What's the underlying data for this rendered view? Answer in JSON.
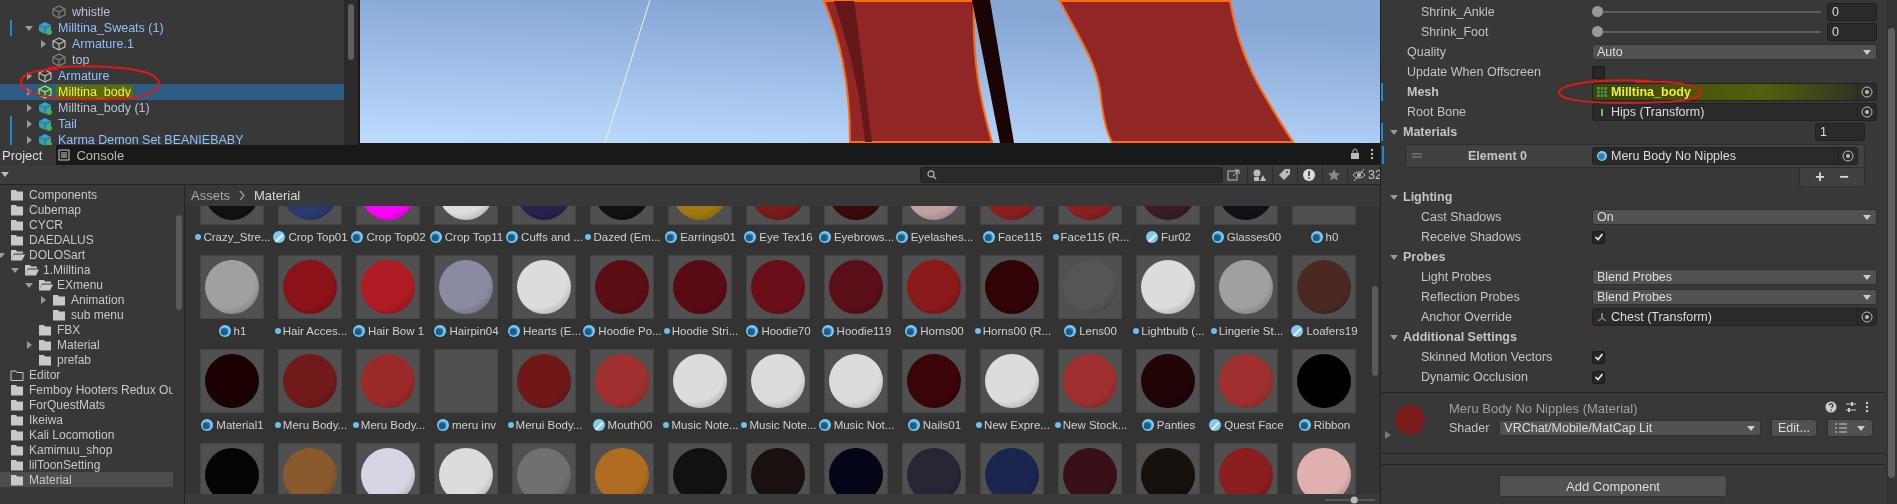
{
  "hierarchy": {
    "continued_children": [
      {
        "label": "whistle",
        "kind": "object",
        "active": false,
        "selected": false,
        "highlighted": false,
        "overridden": false
      }
    ],
    "items": [
      {
        "label": "Milltina_Sweats (1)",
        "kind": "prefab",
        "expanded": true,
        "active": true,
        "selected": false,
        "highlighted": false,
        "overridden": true,
        "children": [
          {
            "label": "Armature.1",
            "kind": "object",
            "expanded": false,
            "active": true,
            "selected": false,
            "highlighted": false,
            "overridden": false
          },
          {
            "label": "top",
            "kind": "object",
            "active": false,
            "selected": false,
            "highlighted": false,
            "overridden": false
          }
        ]
      },
      {
        "label": "Armature",
        "kind": "object",
        "expanded": false,
        "active": true,
        "selected": false,
        "highlighted": false,
        "overridden": false
      },
      {
        "label": "Milltina_body",
        "kind": "object",
        "expanded": false,
        "active": true,
        "selected": true,
        "highlighted": true,
        "overridden": false
      },
      {
        "label": "Milltina_body (1)",
        "kind": "prefab",
        "expanded": false,
        "active": false,
        "selected": false,
        "highlighted": false,
        "overridden": false
      },
      {
        "label": "Tail",
        "kind": "prefab",
        "expanded": false,
        "active": true,
        "selected": false,
        "highlighted": false,
        "overridden": true
      },
      {
        "label": "Karma Demon Set BEANIEBABY",
        "kind": "prefab",
        "expanded": false,
        "active": true,
        "selected": false,
        "highlighted": false,
        "overridden": true
      }
    ]
  },
  "project": {
    "tabs": [
      {
        "label": "Project",
        "kind": "plain",
        "selected": true
      },
      {
        "label": "Console",
        "kind": "console",
        "selected": false
      }
    ],
    "hidden_count": "32",
    "folders": [
      {
        "label": "Components",
        "empty": false,
        "selected": false
      },
      {
        "label": "Cubemap",
        "empty": false,
        "selected": false
      },
      {
        "label": "CYCR",
        "empty": false,
        "selected": false
      },
      {
        "label": "DAEDALUS",
        "empty": false,
        "selected": false
      },
      {
        "label": "DOLOSart",
        "expanded": true,
        "empty": false,
        "selected": false,
        "children": [
          {
            "label": "1.Milltina",
            "expanded": true,
            "empty": false,
            "selected": false,
            "children": [
              {
                "label": "EXmenu",
                "expanded": true,
                "empty": false,
                "selected": false,
                "children": [
                  {
                    "label": "Animation",
                    "expanded": false,
                    "empty": false,
                    "selected": false
                  },
                  {
                    "label": "sub menu",
                    "empty": false,
                    "selected": false
                  }
                ]
              },
              {
                "label": "FBX",
                "empty": false,
                "selected": false
              },
              {
                "label": "Material",
                "expanded": false,
                "empty": false,
                "selected": false
              },
              {
                "label": "prefab",
                "empty": false,
                "selected": false
              }
            ]
          }
        ]
      },
      {
        "label": "Editor",
        "empty": true,
        "selected": false
      },
      {
        "label": "Femboy Hooters Redux Ou",
        "empty": false,
        "selected": false
      },
      {
        "label": "ForQuestMats",
        "empty": false,
        "selected": false
      },
      {
        "label": "Ikeiwa",
        "empty": false,
        "selected": false
      },
      {
        "label": "Kali Locomotion",
        "empty": false,
        "selected": false
      },
      {
        "label": "Kamimuu_shop",
        "empty": false,
        "selected": false
      },
      {
        "label": "lilToonSetting",
        "empty": false,
        "selected": false
      },
      {
        "label": "Material",
        "empty": false,
        "selected": true
      }
    ],
    "breadcrumb": [
      "Assets",
      "Material"
    ],
    "assets": [
      {
        "name": "Crazy_Stre...",
        "kind": "dot",
        "color": "#111111"
      },
      {
        "name": "Crop Top01",
        "kind": "variant",
        "color": "#2a3a70"
      },
      {
        "name": "Crop Top02",
        "kind": "sphere",
        "color": "#ff00ff"
      },
      {
        "name": "Crop Top11",
        "kind": "sphere",
        "color": "#dddddd"
      },
      {
        "name": "Cuffs and ...",
        "kind": "sphere",
        "color": "#2a2050"
      },
      {
        "name": "Dazed (Em...",
        "kind": "dot",
        "color": "#111111"
      },
      {
        "name": "Earrings01",
        "kind": "sphere",
        "color": "#a07a10"
      },
      {
        "name": "Eye Tex16",
        "kind": "sphere",
        "color": "#7a1a1a"
      },
      {
        "name": "Eyebrows...",
        "kind": "sphere",
        "color": "#3a0a0a"
      },
      {
        "name": "Eyelashes...",
        "kind": "sphere",
        "color": "#c0a0a0"
      },
      {
        "name": "Face115",
        "kind": "sphere",
        "color": "#8a2020"
      },
      {
        "name": "Face115 (R...",
        "kind": "dot",
        "color": "#8a2020"
      },
      {
        "name": "Fur02",
        "kind": "variant",
        "color": "#3a1a25"
      },
      {
        "name": "Glasses00",
        "kind": "sphere",
        "color": "#111118"
      },
      {
        "name": "h0",
        "kind": "sphere"
      },
      {
        "name": "h1",
        "kind": "sphere",
        "color": "#a0a0a0"
      },
      {
        "name": "Hair Acces...",
        "kind": "dot",
        "color": "#8b1218"
      },
      {
        "name": "Hair Bow 1",
        "kind": "sphere",
        "color": "#b01a22"
      },
      {
        "name": "Hairpin04",
        "kind": "sphere",
        "color": "#8a8aa0"
      },
      {
        "name": "Hearts (E...",
        "kind": "sphere",
        "color": "#dcdcdc"
      },
      {
        "name": "Hoodie Po...",
        "kind": "sphere",
        "color": "#5a0e14"
      },
      {
        "name": "Hoodie Stri...",
        "kind": "dot",
        "color": "#5a0a14"
      },
      {
        "name": "Hoodie70",
        "kind": "sphere",
        "color": "#6a0f1a"
      },
      {
        "name": "Hoodie119",
        "kind": "sphere",
        "color": "#5a0e18"
      },
      {
        "name": "Horns00",
        "kind": "sphere",
        "color": "#8a1a1a"
      },
      {
        "name": "Horns00 (R...",
        "kind": "dot",
        "color": "#300406"
      },
      {
        "name": "Lens00",
        "kind": "sphere",
        "color": "#555555"
      },
      {
        "name": "Lightbulb (...",
        "kind": "dot",
        "color": "#dcdcdc"
      },
      {
        "name": "Lingerie St...",
        "kind": "dot",
        "color": "#a0a0a0"
      },
      {
        "name": "Loafers19",
        "kind": "variant",
        "color": "#4a2a20"
      },
      {
        "name": "Material1",
        "kind": "sphere",
        "color": "#1a0000"
      },
      {
        "name": "Meru Body...",
        "kind": "dot",
        "color": "#701a1a"
      },
      {
        "name": "Meru Body...",
        "kind": "dot",
        "color": "#9a2a28"
      },
      {
        "name": "meru inv",
        "kind": "sphere"
      },
      {
        "name": "Merui Body...",
        "kind": "dot",
        "color": "#701818"
      },
      {
        "name": "Mouth00",
        "kind": "variant",
        "color": "#a03030"
      },
      {
        "name": "Music Note...",
        "kind": "dot",
        "color": "#dcdcdc"
      },
      {
        "name": "Music Note...",
        "kind": "dot",
        "color": "#dcdcdc"
      },
      {
        "name": "Music Not...",
        "kind": "sphere",
        "color": "#dcdcdc"
      },
      {
        "name": "Nails01",
        "kind": "sphere",
        "color": "#3a0408"
      },
      {
        "name": "New Expre...",
        "kind": "dot",
        "color": "#dcdcdc"
      },
      {
        "name": "New Stock...",
        "kind": "dot",
        "color": "#a03030"
      },
      {
        "name": "Panties",
        "kind": "sphere",
        "color": "#200406"
      },
      {
        "name": "Quest Face",
        "kind": "variant",
        "color": "#a03030"
      },
      {
        "name": "Ribbon",
        "kind": "sphere",
        "color": "#000000"
      }
    ],
    "partial_row": [
      {
        "color": "#050505"
      },
      {
        "color": "#8a5a2c"
      },
      {
        "color": "#d8d4e4"
      },
      {
        "color": "#dcdcdc"
      },
      {
        "color": "#707070"
      },
      {
        "color": "#b06d1f"
      },
      {
        "color": "#111111"
      },
      {
        "color": "#1a1010"
      },
      {
        "color": "#05051a"
      },
      {
        "color": "#2a2535"
      },
      {
        "color": "#1a2550"
      },
      {
        "color": "#3a1018"
      },
      {
        "color": "#15100c"
      },
      {
        "color": "#8b1e1e"
      },
      {
        "color": "#e0b0b0"
      }
    ],
    "thumbnail_size": {
      "level": 0.6
    }
  },
  "inspector": {
    "continued_rows": [
      {
        "kind": "slider",
        "label": "Shrink_Ankle",
        "level": 0,
        "value": "0"
      },
      {
        "kind": "slider",
        "label": "Shrink_Foot",
        "level": 0,
        "value": "0"
      }
    ],
    "rows": [
      {
        "kind": "dropdown",
        "label": "Quality",
        "value": "Auto",
        "overridden": false
      },
      {
        "kind": "checkbox",
        "label": "Update When Offscreen",
        "checked": false,
        "overridden": false
      },
      {
        "kind": "object",
        "label": "Mesh",
        "field": {
          "kind": "mesh",
          "value": "Milltina_body"
        },
        "overridden": true,
        "highlighted": true
      },
      {
        "kind": "object",
        "label": "Root Bone",
        "field": {
          "kind": "bone",
          "value": "Hips (Transform)"
        },
        "overridden": false,
        "highlighted": false
      },
      {
        "kind": "foldout",
        "label": "Materials",
        "expanded": true,
        "count": "1",
        "overridden": true,
        "children": [
          {
            "kind": "element",
            "label": "Element 0",
            "value": "Meru Body No Nipples",
            "overridden": true
          }
        ]
      },
      {
        "kind": "foldout",
        "label": "Lighting",
        "expanded": true,
        "overridden": false,
        "children": [
          {
            "kind": "dropdown",
            "label": "Cast Shadows",
            "value": "On",
            "overridden": false
          },
          {
            "kind": "checkbox",
            "label": "Receive Shadows",
            "checked": true,
            "overridden": false
          }
        ]
      },
      {
        "kind": "foldout",
        "label": "Probes",
        "expanded": true,
        "overridden": false,
        "children": [
          {
            "kind": "dropdown",
            "label": "Light Probes",
            "value": "Blend Probes",
            "overridden": false
          },
          {
            "kind": "dropdown",
            "label": "Reflection Probes",
            "value": "Blend Probes",
            "overridden": false
          },
          {
            "kind": "object",
            "label": "Anchor Override",
            "field": {
              "kind": "transform",
              "value": "Chest (Transform)"
            },
            "overridden": false,
            "highlighted": false
          }
        ]
      },
      {
        "kind": "foldout",
        "label": "Additional Settings",
        "expanded": true,
        "overridden": false,
        "children": [
          {
            "kind": "checkbox",
            "label": "Skinned Motion Vectors",
            "checked": true,
            "overridden": false
          },
          {
            "kind": "checkbox",
            "label": "Dynamic Occlusion",
            "checked": true,
            "overridden": false
          }
        ]
      }
    ],
    "array_buttons": [
      "+",
      "−"
    ],
    "material": {
      "title": "Meru Body No Nipples (Material)",
      "color": "#7a1c1c",
      "shader_label": "Shader",
      "shader": "VRChat/Mobile/MatCap Lit",
      "edit_button": "Edit..."
    },
    "add_component": "Add Component"
  }
}
